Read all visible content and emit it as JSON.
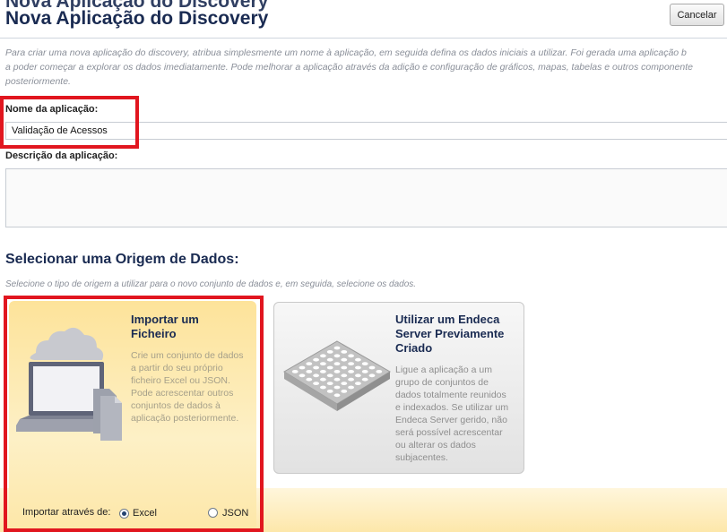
{
  "header": {
    "partial_text": "Nova Aplicação do Discovery",
    "title": "Nova Aplicação do Discovery",
    "cancel_label": "Cancelar"
  },
  "intro_lines": [
    "Para criar uma nova aplicação do discovery, atribua simplesmente um nome à aplicação, em seguida defina os dados iniciais a utilizar. Foi gerada uma aplicação b",
    "a poder começar a explorar os dados imediatamente. Pode melhorar a aplicação através da adição e configuração de gráficos, mapas, tabelas e outros componente",
    "posteriormente."
  ],
  "form": {
    "name_label": "Nome da aplicação:",
    "name_value": "Validação de Acessos",
    "description_label": "Descrição da aplicação:",
    "description_value": ""
  },
  "data_source": {
    "title": "Selecionar uma Origem de Dados:",
    "subtitle": "Selecione o tipo de origem a utilizar para o novo conjunto de dados e, em seguida, selecione os dados.",
    "import_card": {
      "title_lines": [
        "Importar um",
        "Ficheiro"
      ],
      "desc_lines": [
        "Crie um conjunto de dados",
        "a partir do seu próprio",
        "ficheiro Excel ou JSON.",
        "Pode acrescentar outros",
        "conjuntos de dados à",
        "aplicação posteriormente."
      ],
      "import_via_label": "Importar através de:",
      "options": [
        {
          "label": "Excel",
          "checked": true
        },
        {
          "label": "JSON",
          "checked": false
        }
      ]
    },
    "endeca_card": {
      "title_lines": [
        "Utilizar um Endeca",
        "Server Previamente",
        "Criado"
      ],
      "desc_lines": [
        "Ligue a aplicação a um",
        "grupo de conjuntos de",
        "dados totalmente reunidos",
        "e indexados. Se utilizar um",
        "Endeca Server gerido, não",
        "será possível acrescentar",
        "ou alterar os dados",
        "subjacentes."
      ]
    }
  },
  "colors": {
    "highlight": "#e1161f",
    "title": "#1a2b52",
    "card_yellow": "#fde39a"
  }
}
